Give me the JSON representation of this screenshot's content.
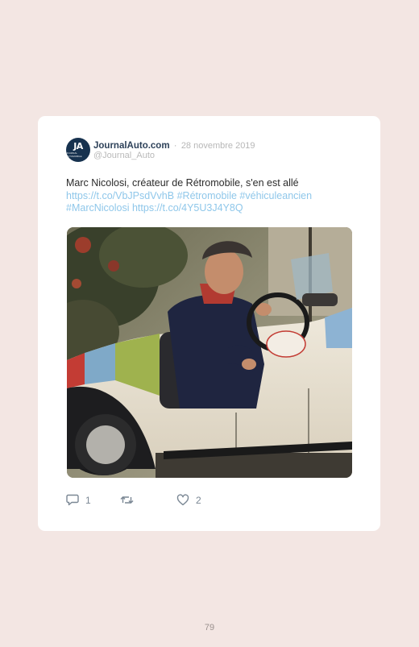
{
  "tweet": {
    "avatar": {
      "initials": "JA",
      "subtitle": "JOURNAL AUTOMOBILE"
    },
    "display_name": "JournalAuto.com",
    "separator": "·",
    "date": "28 novembre 2019",
    "handle": "@Journal_Auto",
    "text": "Marc Nicolosi, créateur de Rétromobile, s'en est allé",
    "link_1": "https://t.co/VbJPsdVvhB",
    "hashtag_1": "#Rétromobile",
    "hashtag_2": "#véhiculeancien",
    "hashtag_3": "#MarcNicolosi",
    "link_2": "https://t.co/4Y5U3J4Y8Q",
    "replies": "1",
    "likes": "2",
    "colors": {
      "name": "#2d4159",
      "link": "#8fc7ea",
      "text": "#2b2b2b"
    }
  },
  "page": {
    "number": "79",
    "background": "#f3e6e3"
  }
}
